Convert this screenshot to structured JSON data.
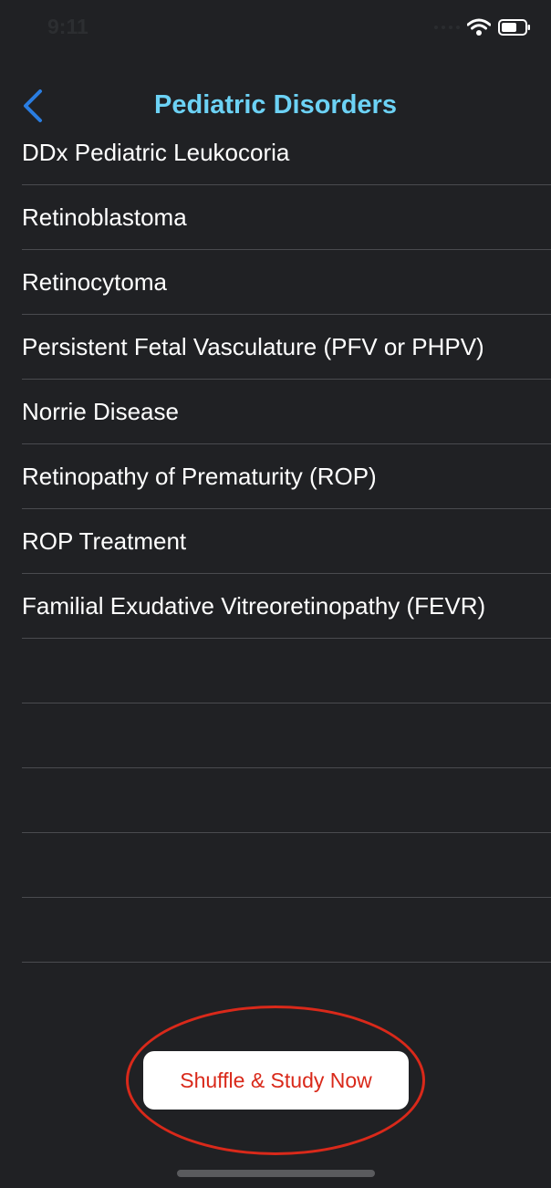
{
  "status_bar": {
    "time": "9:11",
    "icons": [
      "cellular-dots-icon",
      "wifi-icon",
      "battery-icon"
    ]
  },
  "nav": {
    "back_icon": "chevron-left-icon",
    "title": "Pediatric Disorders"
  },
  "list": {
    "items": [
      {
        "label": "DDx Pediatric Leukocoria"
      },
      {
        "label": "Retinoblastoma"
      },
      {
        "label": "Retinocytoma"
      },
      {
        "label": "Persistent Fetal Vasculature (PFV or PHPV)"
      },
      {
        "label": "Norrie Disease"
      },
      {
        "label": "Retinopathy of Prematurity (ROP)"
      },
      {
        "label": "ROP Treatment"
      },
      {
        "label": "Familial Exudative Vitreoretinopathy (FEVR)"
      },
      {
        "label": ""
      },
      {
        "label": ""
      },
      {
        "label": ""
      },
      {
        "label": ""
      },
      {
        "label": ""
      }
    ]
  },
  "footer": {
    "shuffle_label": "Shuffle & Study Now"
  },
  "colors": {
    "background": "#202124",
    "accent_blue": "#2a7de1",
    "title_cyan": "#6cd2f5",
    "separator": "#4a4b4f",
    "button_text_red": "#d9291a",
    "annotation_red": "#d9291a"
  }
}
